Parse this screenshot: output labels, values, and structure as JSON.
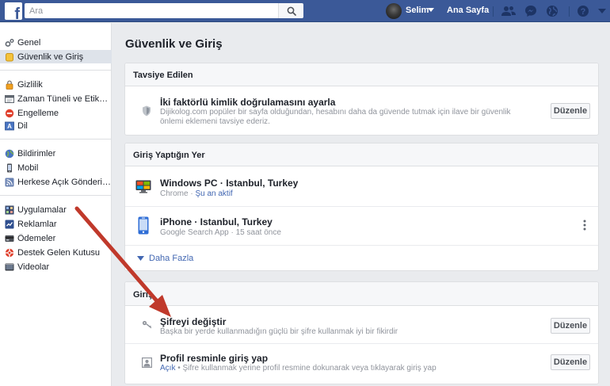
{
  "topbar": {
    "logo": "f",
    "search_placeholder": "Ara",
    "user_name": "Selim",
    "home_label": "Ana Sayfa",
    "icons": [
      "friends-icon",
      "messenger-icon",
      "globe-icon",
      "help-icon",
      "caret-down-icon"
    ]
  },
  "sidebar": {
    "groups": [
      {
        "items": [
          {
            "label": "Genel",
            "icon": "gear-icon"
          },
          {
            "label": "Güvenlik ve Giriş",
            "icon": "shield-icon",
            "active": true
          }
        ]
      },
      {
        "items": [
          {
            "label": "Gizlilik",
            "icon": "lock-icon"
          },
          {
            "label": "Zaman Tüneli ve Etiketl...",
            "icon": "timeline-icon"
          },
          {
            "label": "Engelleme",
            "icon": "block-icon"
          },
          {
            "label": "Dil",
            "icon": "language-icon"
          }
        ]
      },
      {
        "items": [
          {
            "label": "Bildirimler",
            "icon": "globe-icon"
          },
          {
            "label": "Mobil",
            "icon": "mobile-icon"
          },
          {
            "label": "Herkese Açık Gönderiler",
            "icon": "rss-icon"
          }
        ]
      },
      {
        "items": [
          {
            "label": "Uygulamalar",
            "icon": "apps-icon"
          },
          {
            "label": "Reklamlar",
            "icon": "ads-icon"
          },
          {
            "label": "Ödemeler",
            "icon": "payments-icon"
          },
          {
            "label": "Destek Gelen Kutusu",
            "icon": "support-icon"
          },
          {
            "label": "Videolar",
            "icon": "video-icon"
          }
        ]
      }
    ]
  },
  "main": {
    "title": "Güvenlik ve Giriş",
    "recommended": {
      "header": "Tavsiye Edilen",
      "item": {
        "title": "İki faktörlü kimlik doğrulamasını ayarla",
        "description": "Dijikolog.com popüler bir sayfa olduğundan, hesabını daha da güvende tutmak için ilave bir güvenlik önlemi eklemeni tavsiye ederiz.",
        "button": "Düzenle"
      }
    },
    "where_logged_in": {
      "header": "Giriş Yaptığın Yer",
      "sessions": [
        {
          "device": "Windows PC · Istanbul, Turkey",
          "app": "Chrome · ",
          "status": "Şu an aktif"
        },
        {
          "device": "iPhone · Istanbul, Turkey",
          "app": "Google Search App · ",
          "status": "15 saat önce"
        }
      ],
      "more": "Daha Fazla"
    },
    "login": {
      "header": "Giriş",
      "items": [
        {
          "title": "Şifreyi değiştir",
          "sub_link": "",
          "sub": "Başka bir yerde kullanmadığın güçlü bir şifre kullanmak iyi bir fikirdir",
          "button": "Düzenle"
        },
        {
          "title": "Profil resminle giriş yap",
          "sub_link": "Açık",
          "sub": " • Şifre kullanmak yerine profil resmine dokunarak veya tıklayarak giriş yap",
          "button": "Düzenle"
        }
      ]
    }
  },
  "colors": {
    "brand": "#3b5998",
    "link": "#4267b2",
    "arrow": "#c0392b"
  }
}
